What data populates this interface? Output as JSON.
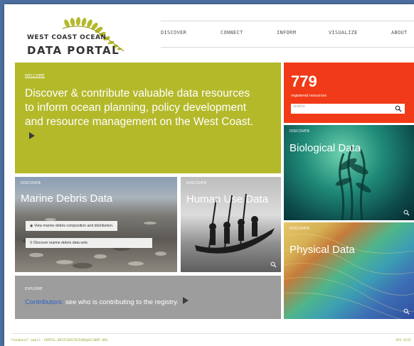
{
  "logo": {
    "line1": "WEST COAST OCEAN",
    "line2": "DATA PORTAL",
    "colors": {
      "fern": "#b4b92a",
      "text": "#333333"
    }
  },
  "nav": {
    "items": [
      {
        "label": "DISCOVER"
      },
      {
        "label": "CONNECT"
      },
      {
        "label": "INFORM"
      },
      {
        "label": "VISUALIZE"
      },
      {
        "label": "ABOUT"
      }
    ]
  },
  "welcome": {
    "tag": "WELCOME",
    "text": "Discover & contribute valuable data resources to inform ocean planning, policy development and resource management on the West Coast.",
    "arrow_icon": "play-arrow-icon",
    "color": "#b4b92a"
  },
  "counter": {
    "value": "779",
    "label": "registered resources",
    "search_placeholder": "SEARCH",
    "search_icon": "search-icon",
    "color": "#f13a17"
  },
  "tiles": {
    "bio": {
      "tag": "DISCOVER",
      "title": "Biological Data"
    },
    "phys": {
      "tag": "DISCOVER",
      "title": "Physical Data"
    },
    "debris": {
      "tag": "DISCOVER",
      "title": "Marine Debris Data",
      "link1": "View marine debris composition and distribution.",
      "link2": "Discover marine debris data sets."
    },
    "human": {
      "tag": "DISCOVER",
      "title": "Human Use Data"
    }
  },
  "explore": {
    "tag": "EXPLORE",
    "link": "Contributors:",
    "text": "see who is contributing to the registry.",
    "link_color": "#2a61c8",
    "color": "#9d9d9d"
  },
  "footer": {
    "left": "Feedback? email: PORTAL.WESTCOASTOCEANS@GCCWRP.ORG",
    "right": "API ACCE"
  }
}
